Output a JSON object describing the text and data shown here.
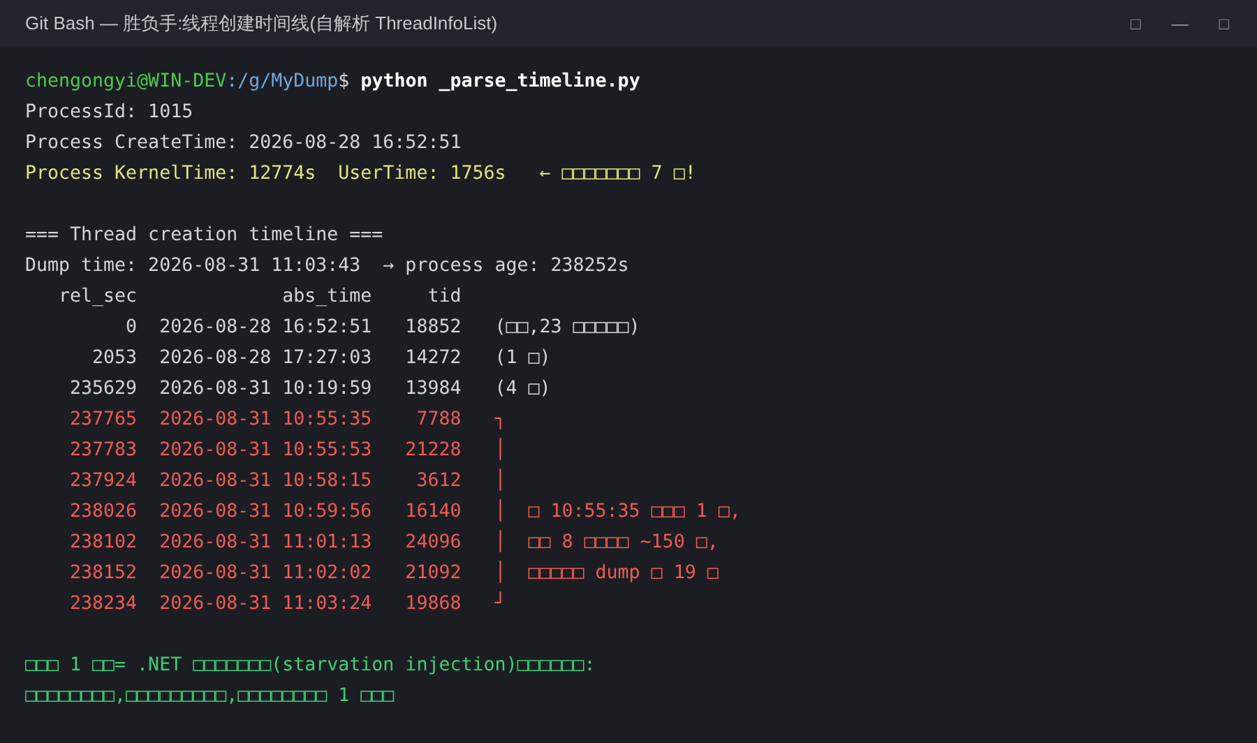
{
  "window": {
    "title": "Git Bash — 胜负手:线程创建时间线(自解析 ThreadInfoList)",
    "controls": [
      "□",
      "—",
      "□"
    ]
  },
  "blocks": [
    {
      "lines": [
        {
          "kind": "prompt",
          "user": "chengongyi@WIN-DEV",
          "path": ":/g/MyDump",
          "symbol": "$",
          "command": "python _parse_timeline.py"
        },
        {
          "kind": "plain",
          "text": "ProcessId: 1015"
        },
        {
          "kind": "plain",
          "text": "Process CreateTime: 2026-08-28 16:52:51"
        },
        {
          "kind": "warning",
          "text": "Process KernelTime: 12774s  UserTime: 1756s   ← □□□□□□□ 7 □!"
        }
      ]
    },
    {
      "lines": [
        {
          "kind": "plain",
          "text": "=== Thread creation timeline ==="
        },
        {
          "kind": "plain",
          "text": "Dump time: 2026-08-31 11:03:43  → process age: 238252s"
        },
        {
          "kind": "plain",
          "text": "   rel_sec             abs_time     tid"
        },
        {
          "kind": "plain",
          "text": "         0  2026-08-28 16:52:51   18852   (□□,23 □□□□□)"
        },
        {
          "kind": "plain",
          "text": "      2053  2026-08-28 17:27:03   14272   (1 □)"
        },
        {
          "kind": "plain",
          "text": "    235629  2026-08-31 10:19:59   13984   (4 □)"
        },
        {
          "kind": "error",
          "text": "    237765  2026-08-31 10:55:35    7788   ┐"
        },
        {
          "kind": "error",
          "text": "    237783  2026-08-31 10:55:53   21228   │"
        },
        {
          "kind": "error",
          "text": "    237924  2026-08-31 10:58:15    3612   │"
        },
        {
          "kind": "error",
          "text": "    238026  2026-08-31 10:59:56   16140   │  □ 10:55:35 □□□ 1 □,"
        },
        {
          "kind": "error",
          "text": "    238102  2026-08-31 11:01:13   24096   │  □□ 8 □□□□ ~150 □,"
        },
        {
          "kind": "error",
          "text": "    238152  2026-08-31 11:02:02   21092   │  □□□□□ dump □ 19 □"
        },
        {
          "kind": "error",
          "text": "    238234  2026-08-31 11:03:24   19868   ┘"
        }
      ]
    },
    {
      "lines": [
        {
          "kind": "success",
          "text": "□□□ 1 □□= .NET □□□□□□□(starvation injection)□□□□□□:"
        },
        {
          "kind": "success",
          "text": "□□□□□□□□,□□□□□□□□□,□□□□□□□□ 1 □□□"
        }
      ]
    }
  ]
}
